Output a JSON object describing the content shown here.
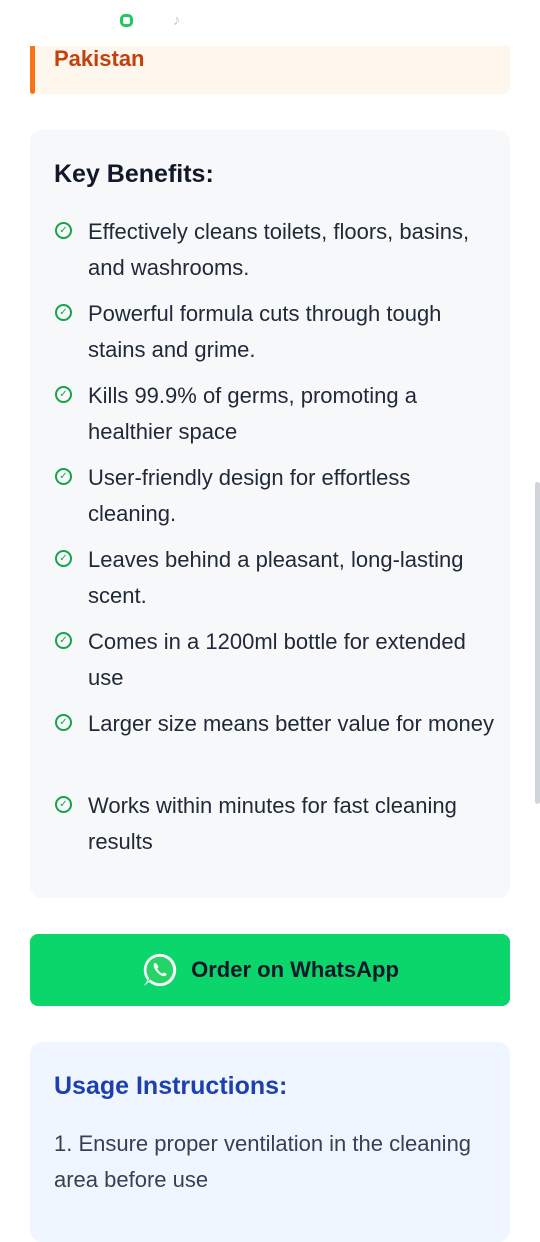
{
  "status_bar": {
    "icons": [
      "app-notification-icon",
      "tiktok-icon"
    ]
  },
  "location": {
    "text": "Pakistan"
  },
  "benefits": {
    "title": "Key Benefits:",
    "items": [
      "Effectively cleans toilets, floors, basins, and washrooms.",
      "Powerful formula cuts through tough stains and grime.",
      "Kills 99.9% of germs, promoting a healthier space",
      "User-friendly design for effortless cleaning.",
      "Leaves behind a pleasant, long-lasting scent.",
      "Comes in a 1200ml bottle for extended use",
      "Larger size means better value for money",
      "Works within minutes for fast cleaning results"
    ]
  },
  "whatsapp": {
    "label": "Order on WhatsApp",
    "icon": "whatsapp-icon"
  },
  "usage": {
    "title": "Usage Instructions:",
    "items": [
      "1. Ensure proper ventilation in the cleaning area before use"
    ]
  },
  "colors": {
    "accent_orange": "#f97316",
    "whatsapp_green": "#0bd66b",
    "check_green": "#16a34a",
    "usage_title_blue": "#1e40af"
  }
}
